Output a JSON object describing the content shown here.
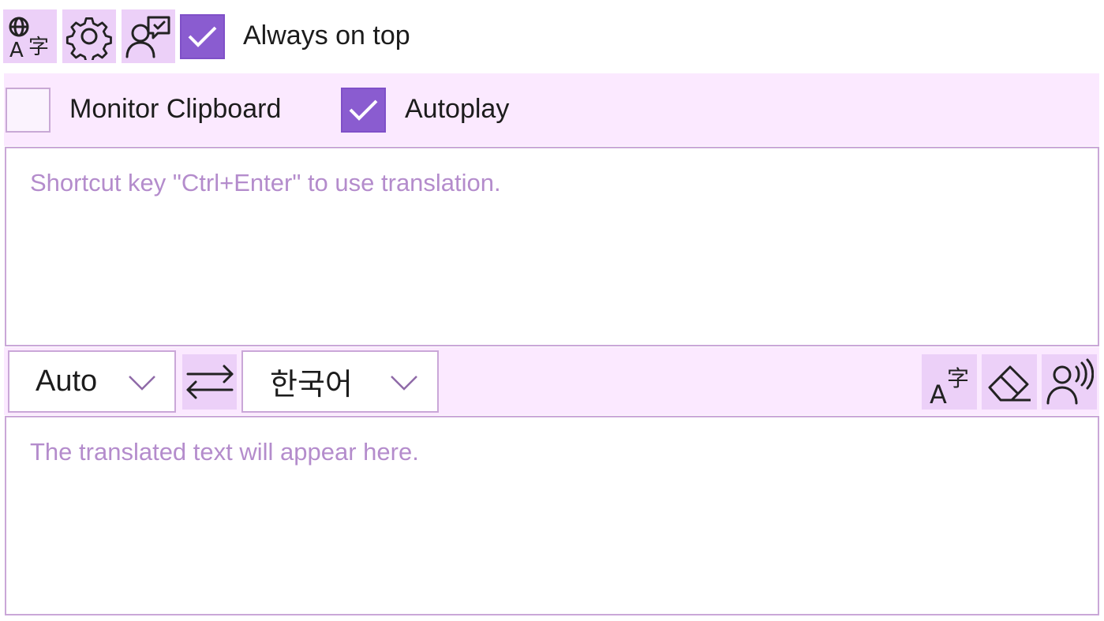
{
  "toolbar": {
    "buttons": [
      {
        "name": "translate-language-icon"
      },
      {
        "name": "gear-icon"
      },
      {
        "name": "feedback-person-icon"
      }
    ],
    "always_on_top": {
      "label": "Always on top",
      "checked": true
    }
  },
  "options": {
    "monitor_clipboard": {
      "label": "Monitor Clipboard",
      "checked": false
    },
    "autoplay": {
      "label": "Autoplay",
      "checked": true
    }
  },
  "source": {
    "placeholder": "Shortcut key \"Ctrl+Enter\" to use translation."
  },
  "language_bar": {
    "source_language": "Auto",
    "target_language": "한국어",
    "swap_icon": "swap-arrows-icon",
    "actions": [
      "translate-icon",
      "eraser-icon",
      "speak-icon"
    ]
  },
  "output": {
    "placeholder": "The translated text will appear here."
  },
  "colors": {
    "accent": "#8a5cd0",
    "band": "#fbe9ff",
    "button": "#ecd0f8",
    "border": "#caa7d8",
    "placeholder": "#b48ccc"
  }
}
